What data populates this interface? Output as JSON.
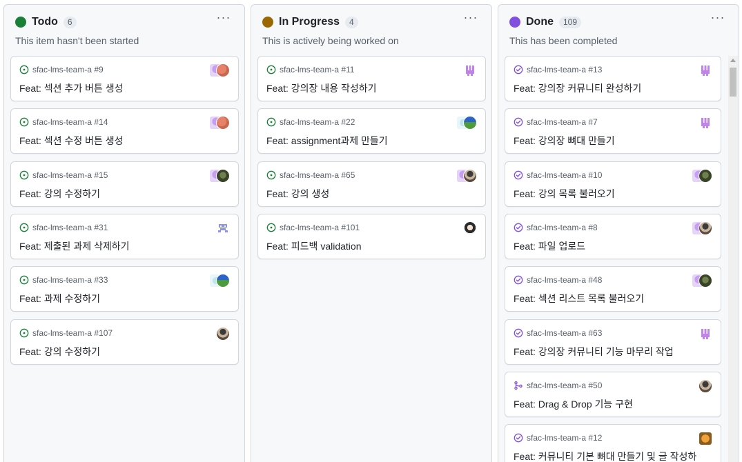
{
  "columns": [
    {
      "title": "Todo",
      "count": "6",
      "description": "This item hasn't been started",
      "color": "#1a7f37",
      "menu": "···",
      "cards": [
        {
          "ref": "sfac-lms-team-a #9",
          "title": "Feat: 섹션 추가 버튼 생성",
          "state": "open",
          "avatars": [
            "purple-pattern",
            "orange-photo"
          ]
        },
        {
          "ref": "sfac-lms-team-a #14",
          "title": "Feat: 섹션 수정 버튼 생성",
          "state": "open",
          "avatars": [
            "purple-pattern",
            "orange-photo"
          ]
        },
        {
          "ref": "sfac-lms-team-a #15",
          "title": "Feat: 강의 수정하기",
          "state": "open",
          "avatars": [
            "purple-pattern",
            "forest-photo"
          ]
        },
        {
          "ref": "sfac-lms-team-a #31",
          "title": "Feat: 제출된 과제 삭제하기",
          "state": "open",
          "avatars": [
            "blue-pattern"
          ]
        },
        {
          "ref": "sfac-lms-team-a #33",
          "title": "Feat: 과제 수정하기",
          "state": "open",
          "avatars": [
            "cyan-pattern",
            "landscape-photo"
          ]
        },
        {
          "ref": "sfac-lms-team-a #107",
          "title": "Feat: 강의 수정하기",
          "state": "open",
          "avatars": [
            "person-photo"
          ]
        }
      ]
    },
    {
      "title": "In Progress",
      "count": "4",
      "description": "This is actively being worked on",
      "color": "#9a6700",
      "menu": "···",
      "cards": [
        {
          "ref": "sfac-lms-team-a #11",
          "title": "Feat: 강의장 내용 작성하기",
          "state": "open",
          "avatars": [
            "purple-pattern-solo"
          ]
        },
        {
          "ref": "sfac-lms-team-a #22",
          "title": "Feat: assignment과제 만들기",
          "state": "open",
          "avatars": [
            "cyan-pattern",
            "landscape-photo"
          ]
        },
        {
          "ref": "sfac-lms-team-a #65",
          "title": "Feat: 강의 생성",
          "state": "open",
          "avatars": [
            "purple-pattern",
            "person-photo"
          ]
        },
        {
          "ref": "sfac-lms-team-a #101",
          "title": "Feat: 피드백 validation",
          "state": "open",
          "avatars": [
            "girl-photo"
          ]
        }
      ]
    },
    {
      "title": "Done",
      "count": "109",
      "description": "This has been completed",
      "color": "#8250df",
      "menu": "···",
      "cards": [
        {
          "ref": "sfac-lms-team-a #13",
          "title": "Feat: 강의장 커뮤니티 완성하기",
          "state": "closed",
          "avatars": [
            "purple-pattern-solo"
          ]
        },
        {
          "ref": "sfac-lms-team-a #7",
          "title": "Feat: 강의장 뼈대 만들기",
          "state": "closed",
          "avatars": [
            "purple-pattern-solo"
          ]
        },
        {
          "ref": "sfac-lms-team-a #10",
          "title": "Feat: 강의 목록 불러오기",
          "state": "closed",
          "avatars": [
            "purple-pattern",
            "forest-photo"
          ]
        },
        {
          "ref": "sfac-lms-team-a #8",
          "title": "Feat: 파일 업로드",
          "state": "closed",
          "avatars": [
            "purple-pattern",
            "person-photo"
          ]
        },
        {
          "ref": "sfac-lms-team-a #48",
          "title": "Feat: 섹션 리스트 목록 불러오기",
          "state": "closed",
          "avatars": [
            "purple-pattern",
            "forest-photo"
          ]
        },
        {
          "ref": "sfac-lms-team-a #63",
          "title": "Feat: 강의장 커뮤니티 기능 마무리 작업",
          "state": "closed",
          "avatars": [
            "purple-pattern-solo"
          ]
        },
        {
          "ref": "sfac-lms-team-a #50",
          "title": "Feat: Drag & Drop 기능 구현",
          "state": "merged",
          "avatars": [
            "person-photo"
          ]
        },
        {
          "ref": "sfac-lms-team-a #12",
          "title": "Feat: 커뮤니티 기본 뼈대 만들기 및 글 작성하",
          "state": "closed",
          "avatars": [
            "tiger-icon"
          ]
        }
      ]
    }
  ]
}
